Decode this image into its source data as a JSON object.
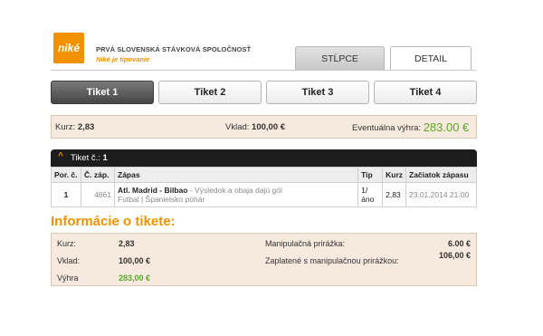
{
  "brand": {
    "logo_text": "niké",
    "line1": "PRVÁ SLOVENSKÁ STÁVKOVÁ SPOLOČNOSŤ",
    "line2": "Niké je tipovanie",
    "accent_color": "#f39200"
  },
  "view_tabs": [
    {
      "label": "STĹPCE"
    },
    {
      "label": "DETAIL",
      "active": true
    }
  ],
  "ticket_tabs": [
    {
      "label": "Tiket 1",
      "active": true
    },
    {
      "label": "Tiket 2"
    },
    {
      "label": "Tiket 3"
    },
    {
      "label": "Tiket 4"
    }
  ],
  "summary": {
    "kurz_label": "Kurz:",
    "kurz_value": "2,83",
    "vklad_label": "Vklad:",
    "vklad_value": "100,00 €",
    "win_label": "Eventuálna výhra:",
    "win_value": "283.00 €"
  },
  "ticket_panel": {
    "chevron": "^",
    "title_label": "Tiket č.:",
    "title_value": "1",
    "columns": [
      "Por. č.",
      "Č. záp.",
      "Zápas",
      "Tip",
      "Kurz",
      "Začiatok zápasu"
    ],
    "rows": [
      {
        "order": "1",
        "match_no": "4861",
        "match": "Atl. Madrid - Bilbao",
        "bet": "- Výsledok a obaja dajú gól",
        "category": "Futbal | Španielsko pohár",
        "tip": "1/áno",
        "odds": "2,83",
        "start": "23.01.2014 21:00"
      }
    ]
  },
  "info": {
    "title": "Informácie o tikete:",
    "kurz_label": "Kurz:",
    "kurz_value": "2,83",
    "vklad_label": "Vklad:",
    "vklad_value": "100,00 €",
    "vyhra_label": "Výhra",
    "vyhra_value": "283,00 €",
    "fee_label": "Manipulačná prirážka:",
    "fee_value": "6.00 €",
    "paid_label": "Zaplatené s manipulačnou prirážkou:",
    "paid_value": "106,00 €"
  }
}
